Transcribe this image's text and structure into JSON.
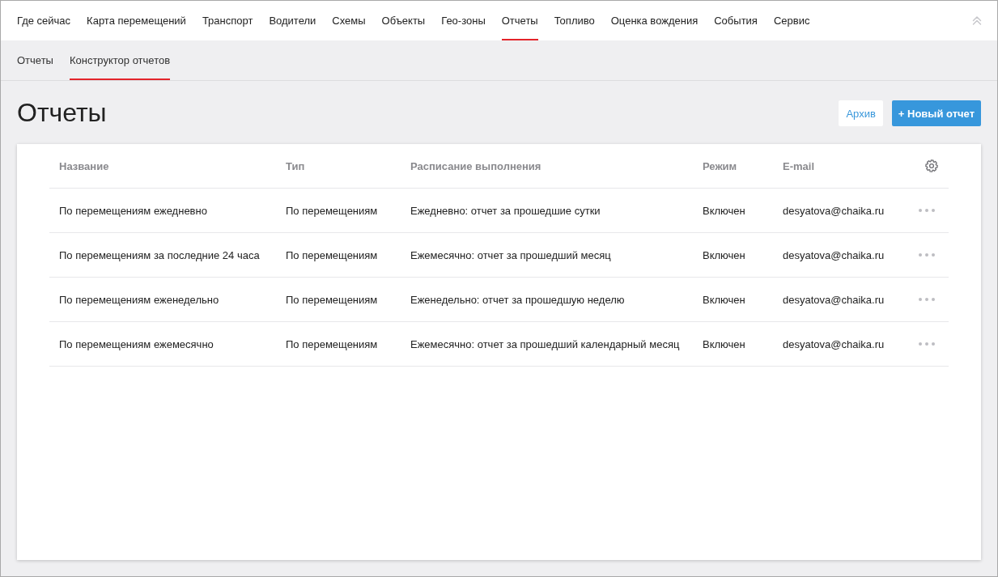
{
  "top_nav": {
    "items": [
      {
        "label": "Где сейчас",
        "selected": false
      },
      {
        "label": "Карта перемещений",
        "selected": false
      },
      {
        "label": "Транспорт",
        "selected": false
      },
      {
        "label": "Водители",
        "selected": false
      },
      {
        "label": "Схемы",
        "selected": false
      },
      {
        "label": "Объекты",
        "selected": false
      },
      {
        "label": "Гео-зоны",
        "selected": false
      },
      {
        "label": "Отчеты",
        "selected": true
      },
      {
        "label": "Топливо",
        "selected": false
      },
      {
        "label": "Оценка вождения",
        "selected": false
      },
      {
        "label": "События",
        "selected": false
      },
      {
        "label": "Сервис",
        "selected": false
      }
    ]
  },
  "sub_nav": {
    "tabs": [
      {
        "label": "Отчеты",
        "selected": false
      },
      {
        "label": "Конструктор отчетов",
        "selected": true
      }
    ]
  },
  "page": {
    "title": "Отчеты",
    "buttons": [
      {
        "label": "Архив",
        "kind": "secondary"
      },
      {
        "label": "+ Новый отчет",
        "kind": "primary"
      }
    ]
  },
  "table": {
    "columns": [
      "Название",
      "Тип",
      "Расписание выполнения",
      "Режим",
      "E-mail"
    ],
    "rows": [
      {
        "name": "По перемещениям ежедневно",
        "type": "По перемещениям",
        "schedule": "Ежедневно: отчет за прошедшие сутки",
        "mode": "Включен",
        "email": "desyatova@chaika.ru"
      },
      {
        "name": "По перемещениям за последние 24 часа",
        "type": "По перемещениям",
        "schedule": "Ежемесячно: отчет за прошедший месяц",
        "mode": "Включен",
        "email": "desyatova@chaika.ru"
      },
      {
        "name": "По перемещениям еженедельно",
        "type": "По перемещениям",
        "schedule": "Еженедельно: отчет за прошедшую неделю",
        "mode": "Включен",
        "email": "desyatova@chaika.ru"
      },
      {
        "name": "По перемещениям ежемесячно",
        "type": "По перемещениям",
        "schedule": "Ежемесячно: отчет за прошедший календарный месяц",
        "mode": "Включен",
        "email": "desyatova@chaika.ru"
      }
    ]
  }
}
